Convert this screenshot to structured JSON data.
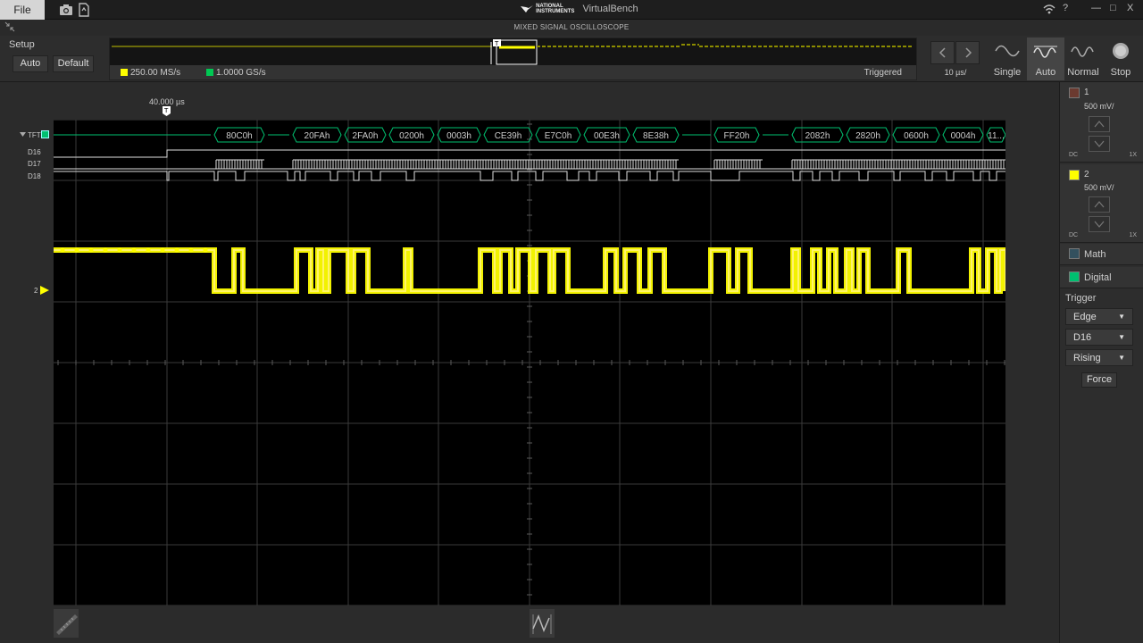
{
  "titlebar": {
    "file_label": "File",
    "brand_line1": "NATIONAL",
    "brand_line2": "INSTRUMENTS",
    "app_name": "VirtualBench",
    "help": "?",
    "minimize": "—",
    "maximize": "□",
    "close": "X"
  },
  "subtitle": "MIXED SIGNAL OSCILLOSCOPE",
  "setup": {
    "label": "Setup",
    "auto_label": "Auto",
    "default_label": "Default"
  },
  "overview": {
    "rates": [
      {
        "label": "250.00 MS/s",
        "color": "#ffff00"
      },
      {
        "label": "1.0000 GS/s",
        "color": "#00c853"
      }
    ],
    "status": "Triggered"
  },
  "timebase": {
    "label": "10 µs/"
  },
  "acquisition": [
    {
      "label": "Single",
      "icon": "single-sine-icon",
      "active": false
    },
    {
      "label": "Auto",
      "icon": "auto-sine-icon",
      "active": true
    },
    {
      "label": "Normal",
      "icon": "normal-sine-icon",
      "active": false
    },
    {
      "label": "Stop",
      "icon": "stop-circle-icon",
      "active": false
    }
  ],
  "trigger_position_label": "40.000 µs",
  "digital_channels": [
    "TFT",
    "D16",
    "D17",
    "D18"
  ],
  "bus_values": [
    "80C0h",
    "20FAh",
    "2FA0h",
    "0200h",
    "0003h",
    "CE39h",
    "E7C0h",
    "00E3h",
    "8E38h",
    "FF20h",
    "2082h",
    "2820h",
    "0600h",
    "0004h",
    "11..."
  ],
  "analog_marker": "2",
  "channels": [
    {
      "num": "1",
      "scale": "500 mV/",
      "coupling": "DC",
      "probe": "1X",
      "color": "#6b3a30"
    },
    {
      "num": "2",
      "scale": "500 mV/",
      "coupling": "DC",
      "probe": "1X",
      "color": "#ffff00"
    }
  ],
  "math_label": "Math",
  "digital_label": "Digital",
  "trigger": {
    "label": "Trigger",
    "type": "Edge",
    "source": "D16",
    "slope": "Rising",
    "force_label": "Force"
  },
  "colors": {
    "analog": "#ffff00",
    "digital": "#00c070",
    "grid": "#3a3a3a"
  }
}
